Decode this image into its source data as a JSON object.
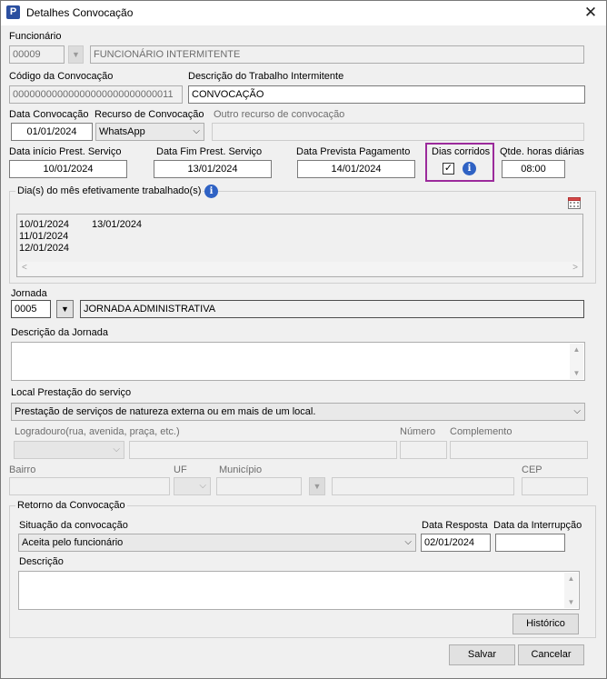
{
  "window": {
    "title": "Detalhes Convocação",
    "app_icon": "P"
  },
  "funcionario": {
    "label": "Funcionário",
    "code": "00009",
    "name": "FUNCIONÁRIO INTERMITENTE"
  },
  "codigo": {
    "label": "Código da Convocação",
    "value": "00000000000000000000000000011"
  },
  "descricao_trabalho": {
    "label": "Descrição do Trabalho Intermitente",
    "value": "CONVOCAÇÃO"
  },
  "data_convocacao": {
    "label": "Data Convocação",
    "value": "01/01/2024"
  },
  "recurso": {
    "label": "Recurso de Convocação",
    "value": "WhatsApp"
  },
  "outro_recurso": {
    "label": "Outro recurso de convocação",
    "value": ""
  },
  "data_inicio": {
    "label": "Data início Prest. Serviço",
    "value": "10/01/2024"
  },
  "data_fim": {
    "label": "Data Fim Prest. Serviço",
    "value": "13/01/2024"
  },
  "data_pagamento": {
    "label": "Data Prevista Pagamento",
    "value": "14/01/2024"
  },
  "dias_corridos": {
    "label": "Dias corridos",
    "checked": true,
    "check_glyph": "✓"
  },
  "qtde_horas": {
    "label": "Qtde. horas diárias",
    "value": "08:00"
  },
  "dias_trabalhados": {
    "label": "Dia(s) do mês efetivamente trabalhado(s)",
    "col1": [
      "10/01/2024",
      "11/01/2024",
      "12/01/2024"
    ],
    "col2": [
      "13/01/2024"
    ]
  },
  "jornada": {
    "label": "Jornada",
    "code": "0005",
    "name": "JORNADA ADMINISTRATIVA"
  },
  "descricao_jornada": {
    "label": "Descrição da Jornada",
    "value": ""
  },
  "local": {
    "label": "Local Prestação do serviço",
    "value": "Prestação de serviços de natureza externa ou em mais de um local."
  },
  "endereco": {
    "logradouro_label": "Logradouro(rua, avenida, praça, etc.)",
    "numero_label": "Número",
    "complemento_label": "Complemento",
    "bairro_label": "Bairro",
    "uf_label": "UF",
    "municipio_label": "Município",
    "cep_label": "CEP"
  },
  "retorno": {
    "group_label": "Retorno da Convocação",
    "situacao_label": "Situação da convocação",
    "situacao_value": "Aceita pelo funcionário",
    "data_resposta_label": "Data Resposta",
    "data_resposta_value": "02/01/2024",
    "data_interrupcao_label": "Data da Interrupção",
    "data_interrupcao_value": "",
    "descricao_label": "Descrição",
    "historico_label": "Histórico"
  },
  "footer": {
    "salvar": "Salvar",
    "cancelar": "Cancelar"
  },
  "icons": {
    "close": "close-icon",
    "dropdown": "chevron-down-icon",
    "info": "info-icon",
    "calendar": "calendar-icon"
  },
  "colors": {
    "highlight": "#9b2a9b",
    "info": "#2f62c4",
    "app_icon": "#2b4fa0"
  }
}
